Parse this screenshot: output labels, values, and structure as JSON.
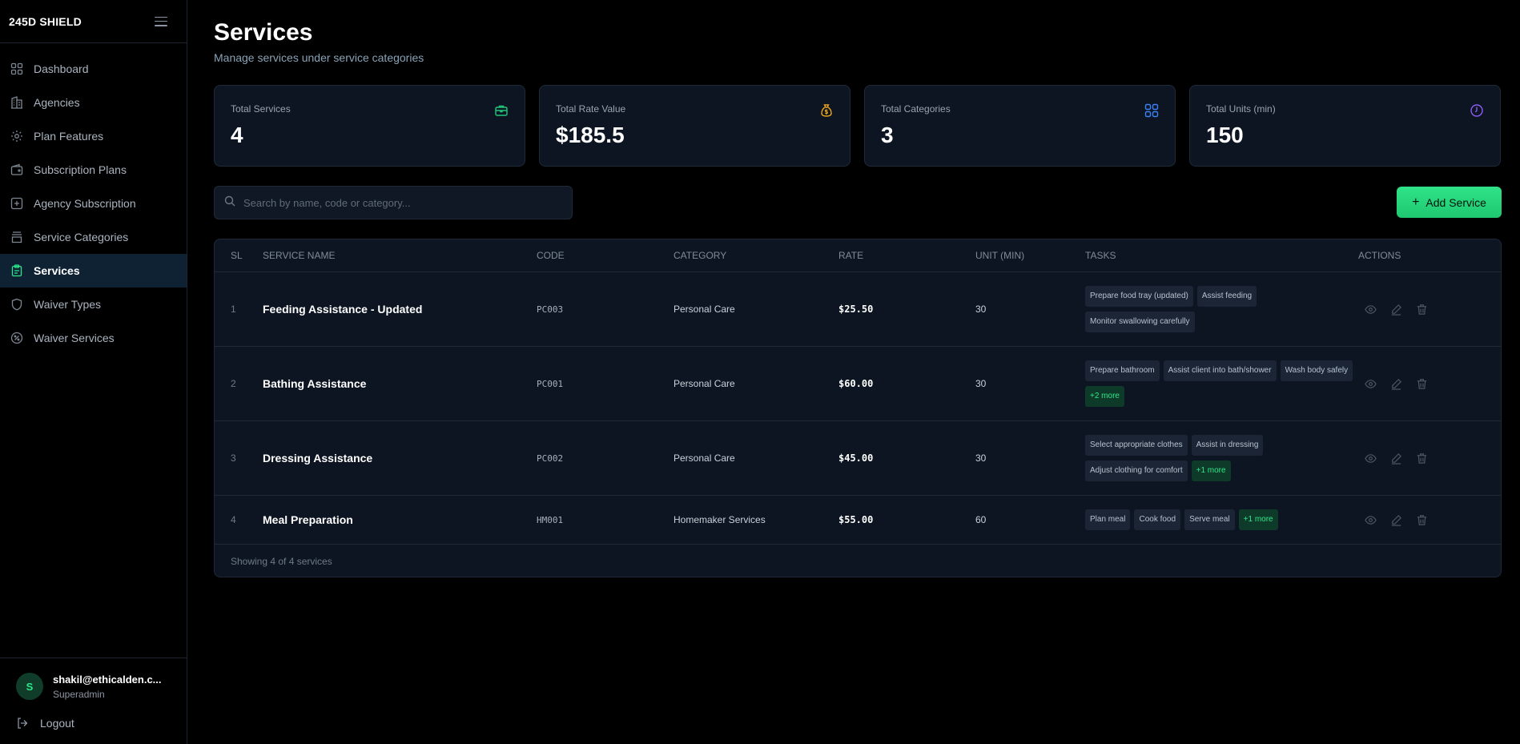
{
  "sidebar": {
    "brand": "245D SHIELD",
    "items": [
      {
        "label": "Dashboard",
        "icon": "grid-icon",
        "active": false
      },
      {
        "label": "Agencies",
        "icon": "building-icon",
        "active": false
      },
      {
        "label": "Plan Features",
        "icon": "gear-icon",
        "active": false
      },
      {
        "label": "Subscription Plans",
        "icon": "wallet-icon",
        "active": false
      },
      {
        "label": "Agency Subscription",
        "icon": "plus-square-icon",
        "active": false
      },
      {
        "label": "Service Categories",
        "icon": "layers-icon",
        "active": false
      },
      {
        "label": "Services",
        "icon": "clipboard-icon",
        "active": true
      },
      {
        "label": "Waiver Types",
        "icon": "shield-icon",
        "active": false
      },
      {
        "label": "Waiver Services",
        "icon": "badge-percent-icon",
        "active": false
      }
    ],
    "user": {
      "initial": "S",
      "email": "shakil@ethicalden.c...",
      "role": "Superadmin"
    },
    "logout_label": "Logout"
  },
  "header": {
    "title": "Services",
    "subtitle": "Manage services under service categories"
  },
  "stats": [
    {
      "label": "Total Services",
      "value": "4",
      "icon": "briefcase-icon",
      "color": "#22c87a"
    },
    {
      "label": "Total Rate Value",
      "value": "$185.5",
      "icon": "money-bag-icon",
      "color": "#e8a21c"
    },
    {
      "label": "Total Categories",
      "value": "3",
      "icon": "grid-icon",
      "color": "#3b82f6"
    },
    {
      "label": "Total Units (min)",
      "value": "150",
      "icon": "clock-icon",
      "color": "#8b5cf6"
    }
  ],
  "search": {
    "placeholder": "Search by name, code or category..."
  },
  "add_button": {
    "label": "Add Service"
  },
  "table": {
    "columns": [
      "SL",
      "SERVICE NAME",
      "CODE",
      "CATEGORY",
      "RATE",
      "UNIT (MIN)",
      "TASKS",
      "ACTIONS"
    ],
    "rows": [
      {
        "sl": "1",
        "name": "Feeding Assistance - Updated",
        "code": "PC003",
        "category": "Personal Care",
        "rate": "$25.50",
        "unit": "30",
        "tasks": [
          "Prepare food tray (updated)",
          "Assist feeding",
          "Monitor swallowing carefully"
        ],
        "more": ""
      },
      {
        "sl": "2",
        "name": "Bathing Assistance",
        "code": "PC001",
        "category": "Personal Care",
        "rate": "$60.00",
        "unit": "30",
        "tasks": [
          "Prepare bathroom",
          "Assist client into bath/shower",
          "Wash body safely"
        ],
        "more": "+2 more"
      },
      {
        "sl": "3",
        "name": "Dressing Assistance",
        "code": "PC002",
        "category": "Personal Care",
        "rate": "$45.00",
        "unit": "30",
        "tasks": [
          "Select appropriate clothes",
          "Assist in dressing",
          "Adjust clothing for comfort"
        ],
        "more": "+1 more"
      },
      {
        "sl": "4",
        "name": "Meal Preparation",
        "code": "HM001",
        "category": "Homemaker Services",
        "rate": "$55.00",
        "unit": "60",
        "tasks": [
          "Plan meal",
          "Cook food",
          "Serve meal"
        ],
        "more": "+1 more"
      }
    ],
    "footer": "Showing 4 of 4 services"
  }
}
